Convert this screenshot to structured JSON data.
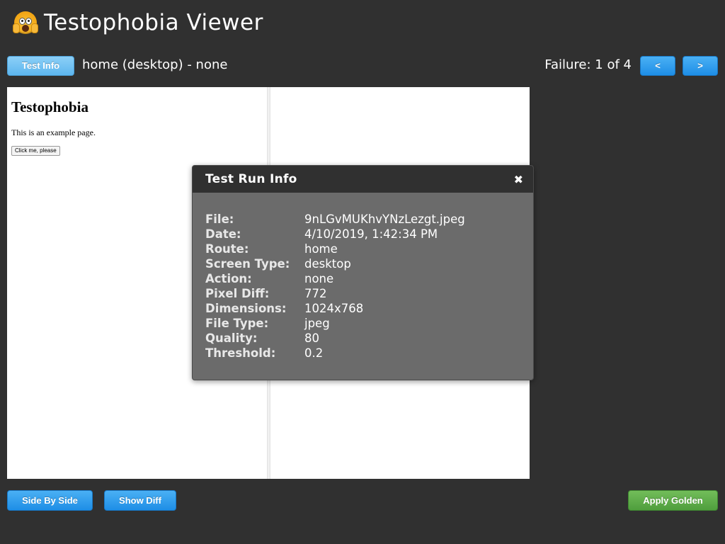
{
  "app": {
    "title": "Testophobia Viewer",
    "logo_icon": "fearful-face-emoji"
  },
  "toolbar": {
    "test_info_label": "Test Info",
    "route_text": "home (desktop) - none",
    "failure_text": "Failure: 1 of 4",
    "prev_label": "<",
    "next_label": ">"
  },
  "preview": {
    "heading": "Testophobia",
    "paragraph": "This is an example page.",
    "button_label": "Click me, please"
  },
  "modal": {
    "title": "Test Run Info",
    "close_icon": "close-icon",
    "rows": [
      {
        "key": "File:",
        "value": "9nLGvMUKhvYNzLezgt.jpeg"
      },
      {
        "key": "Date:",
        "value": "4/10/2019, 1:42:34 PM"
      },
      {
        "key": "Route:",
        "value": "home"
      },
      {
        "key": "Screen Type:",
        "value": "desktop"
      },
      {
        "key": "Action:",
        "value": "none"
      },
      {
        "key": "Pixel Diff:",
        "value": "772"
      },
      {
        "key": "Dimensions:",
        "value": "1024x768"
      },
      {
        "key": "File Type:",
        "value": "jpeg"
      },
      {
        "key": "Quality:",
        "value": "80"
      },
      {
        "key": "Threshold:",
        "value": "0.2"
      }
    ]
  },
  "footer": {
    "side_by_side_label": "Side By Side",
    "show_diff_label": "Show Diff",
    "apply_golden_label": "Apply Golden"
  },
  "colors": {
    "background": "#303030",
    "blue": "#1e8ee6",
    "green": "#4f9e3d",
    "modal": "#6b6b6b"
  }
}
